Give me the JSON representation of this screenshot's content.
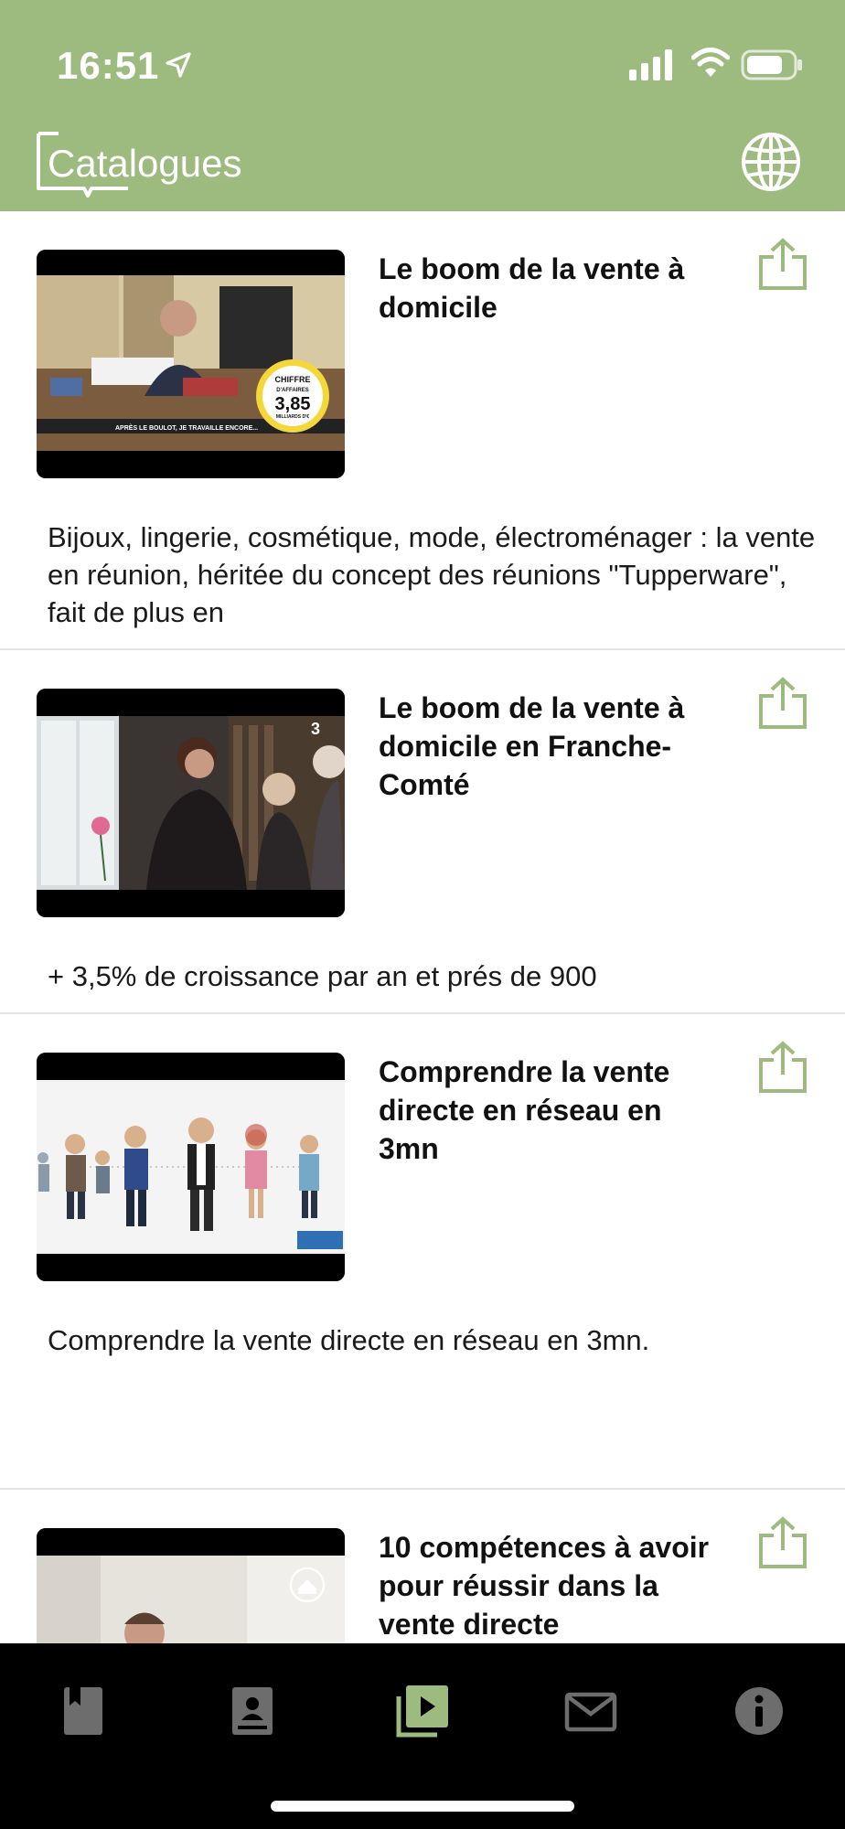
{
  "status_bar": {
    "time": "16:51"
  },
  "header": {
    "title": "Catalogues",
    "globe_icon": "globe-icon"
  },
  "accent_color": "#9dba7f",
  "items": [
    {
      "title": "Le boom de la vente à domicile",
      "description": "Bijoux, lingerie, cosmétique, mode, électroménager : la vente en réunion, héritée du concept des réunions \"Tupperware\", fait de plus en",
      "thumbnail": {
        "badge_line1": "CHIFFRE",
        "badge_line2": "D'AFFAIRES",
        "badge_value": "3,85",
        "badge_line3": "MILLIARDS D'€",
        "caption": "APRÈS LE BOULOT, JE TRAVAILLE ENCORE..."
      }
    },
    {
      "title": "Le boom de la vente à domicile en Franche-Comté",
      "description": "+ 3,5%  de croissance par an et prés de 900",
      "thumbnail": {
        "channel": "3"
      }
    },
    {
      "title": "Comprendre la vente directe en réseau en 3mn",
      "description": "Comprendre la vente directe en réseau en 3mn."
    },
    {
      "title": "10 compétences à avoir pour réussir dans la vente directe",
      "description": ""
    }
  ],
  "tabs": [
    {
      "name": "book-icon",
      "active": false
    },
    {
      "name": "contact-book-icon",
      "active": false
    },
    {
      "name": "video-library-icon",
      "active": true
    },
    {
      "name": "mail-icon",
      "active": false
    },
    {
      "name": "info-icon",
      "active": false
    }
  ]
}
